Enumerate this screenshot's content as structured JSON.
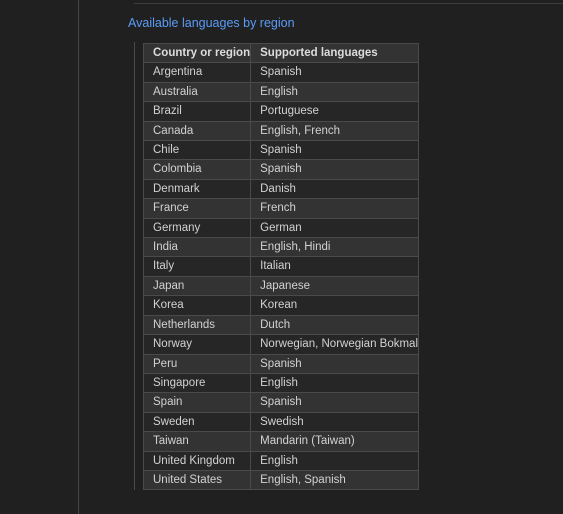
{
  "section": {
    "heading_link": "Available languages by region"
  },
  "table": {
    "columns": [
      "Country or region",
      "Supported languages"
    ],
    "rows": [
      [
        "Argentina",
        "Spanish"
      ],
      [
        "Australia",
        "English"
      ],
      [
        "Brazil",
        "Portuguese"
      ],
      [
        "Canada",
        "English, French"
      ],
      [
        "Chile",
        "Spanish"
      ],
      [
        "Colombia",
        "Spanish"
      ],
      [
        "Denmark",
        "Danish"
      ],
      [
        "France",
        "French"
      ],
      [
        "Germany",
        "German"
      ],
      [
        "India",
        "English, Hindi"
      ],
      [
        "Italy",
        "Italian"
      ],
      [
        "Japan",
        "Japanese"
      ],
      [
        "Korea",
        "Korean"
      ],
      [
        "Netherlands",
        "Dutch"
      ],
      [
        "Norway",
        "Norwegian, Norwegian Bokmal"
      ],
      [
        "Peru",
        "Spanish"
      ],
      [
        "Singapore",
        "English"
      ],
      [
        "Spain",
        "Spanish"
      ],
      [
        "Sweden",
        "Swedish"
      ],
      [
        "Taiwan",
        "Mandarin (Taiwan)"
      ],
      [
        "United Kingdom",
        "English"
      ],
      [
        "United States",
        "English, Spanish"
      ]
    ]
  },
  "colors": {
    "page_background": "#202020",
    "row_dark": "#262626",
    "row_light": "#333333",
    "border": "#4a4a4a",
    "link": "#5a9cf8",
    "text": "#d2d2d2"
  }
}
